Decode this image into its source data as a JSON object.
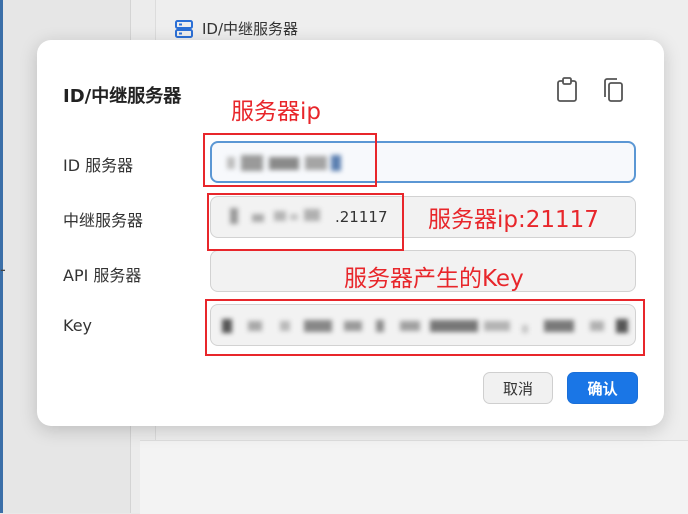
{
  "background": {
    "header_title": "ID/中继服务器",
    "left_fragment": "-"
  },
  "dialog": {
    "title": "ID/中继服务器",
    "icons": {
      "paste": "clipboard-icon",
      "copy": "copy-icon"
    },
    "fields": [
      {
        "label": "ID 服务器",
        "value": ""
      },
      {
        "label": "中继服务器",
        "value": ".21117"
      },
      {
        "label": "API 服务器",
        "value": ""
      },
      {
        "label": "Key",
        "value": ""
      }
    ],
    "cancel_label": "取消",
    "confirm_label": "确认"
  },
  "annotations": {
    "id_server_note": "服务器ip",
    "relay_server_note": "服务器ip:21117",
    "key_note": "服务器产生的Key"
  },
  "colors": {
    "accent": "#1a76e6",
    "annotation_red": "#e8262b",
    "focus_border": "#5b97d4"
  }
}
